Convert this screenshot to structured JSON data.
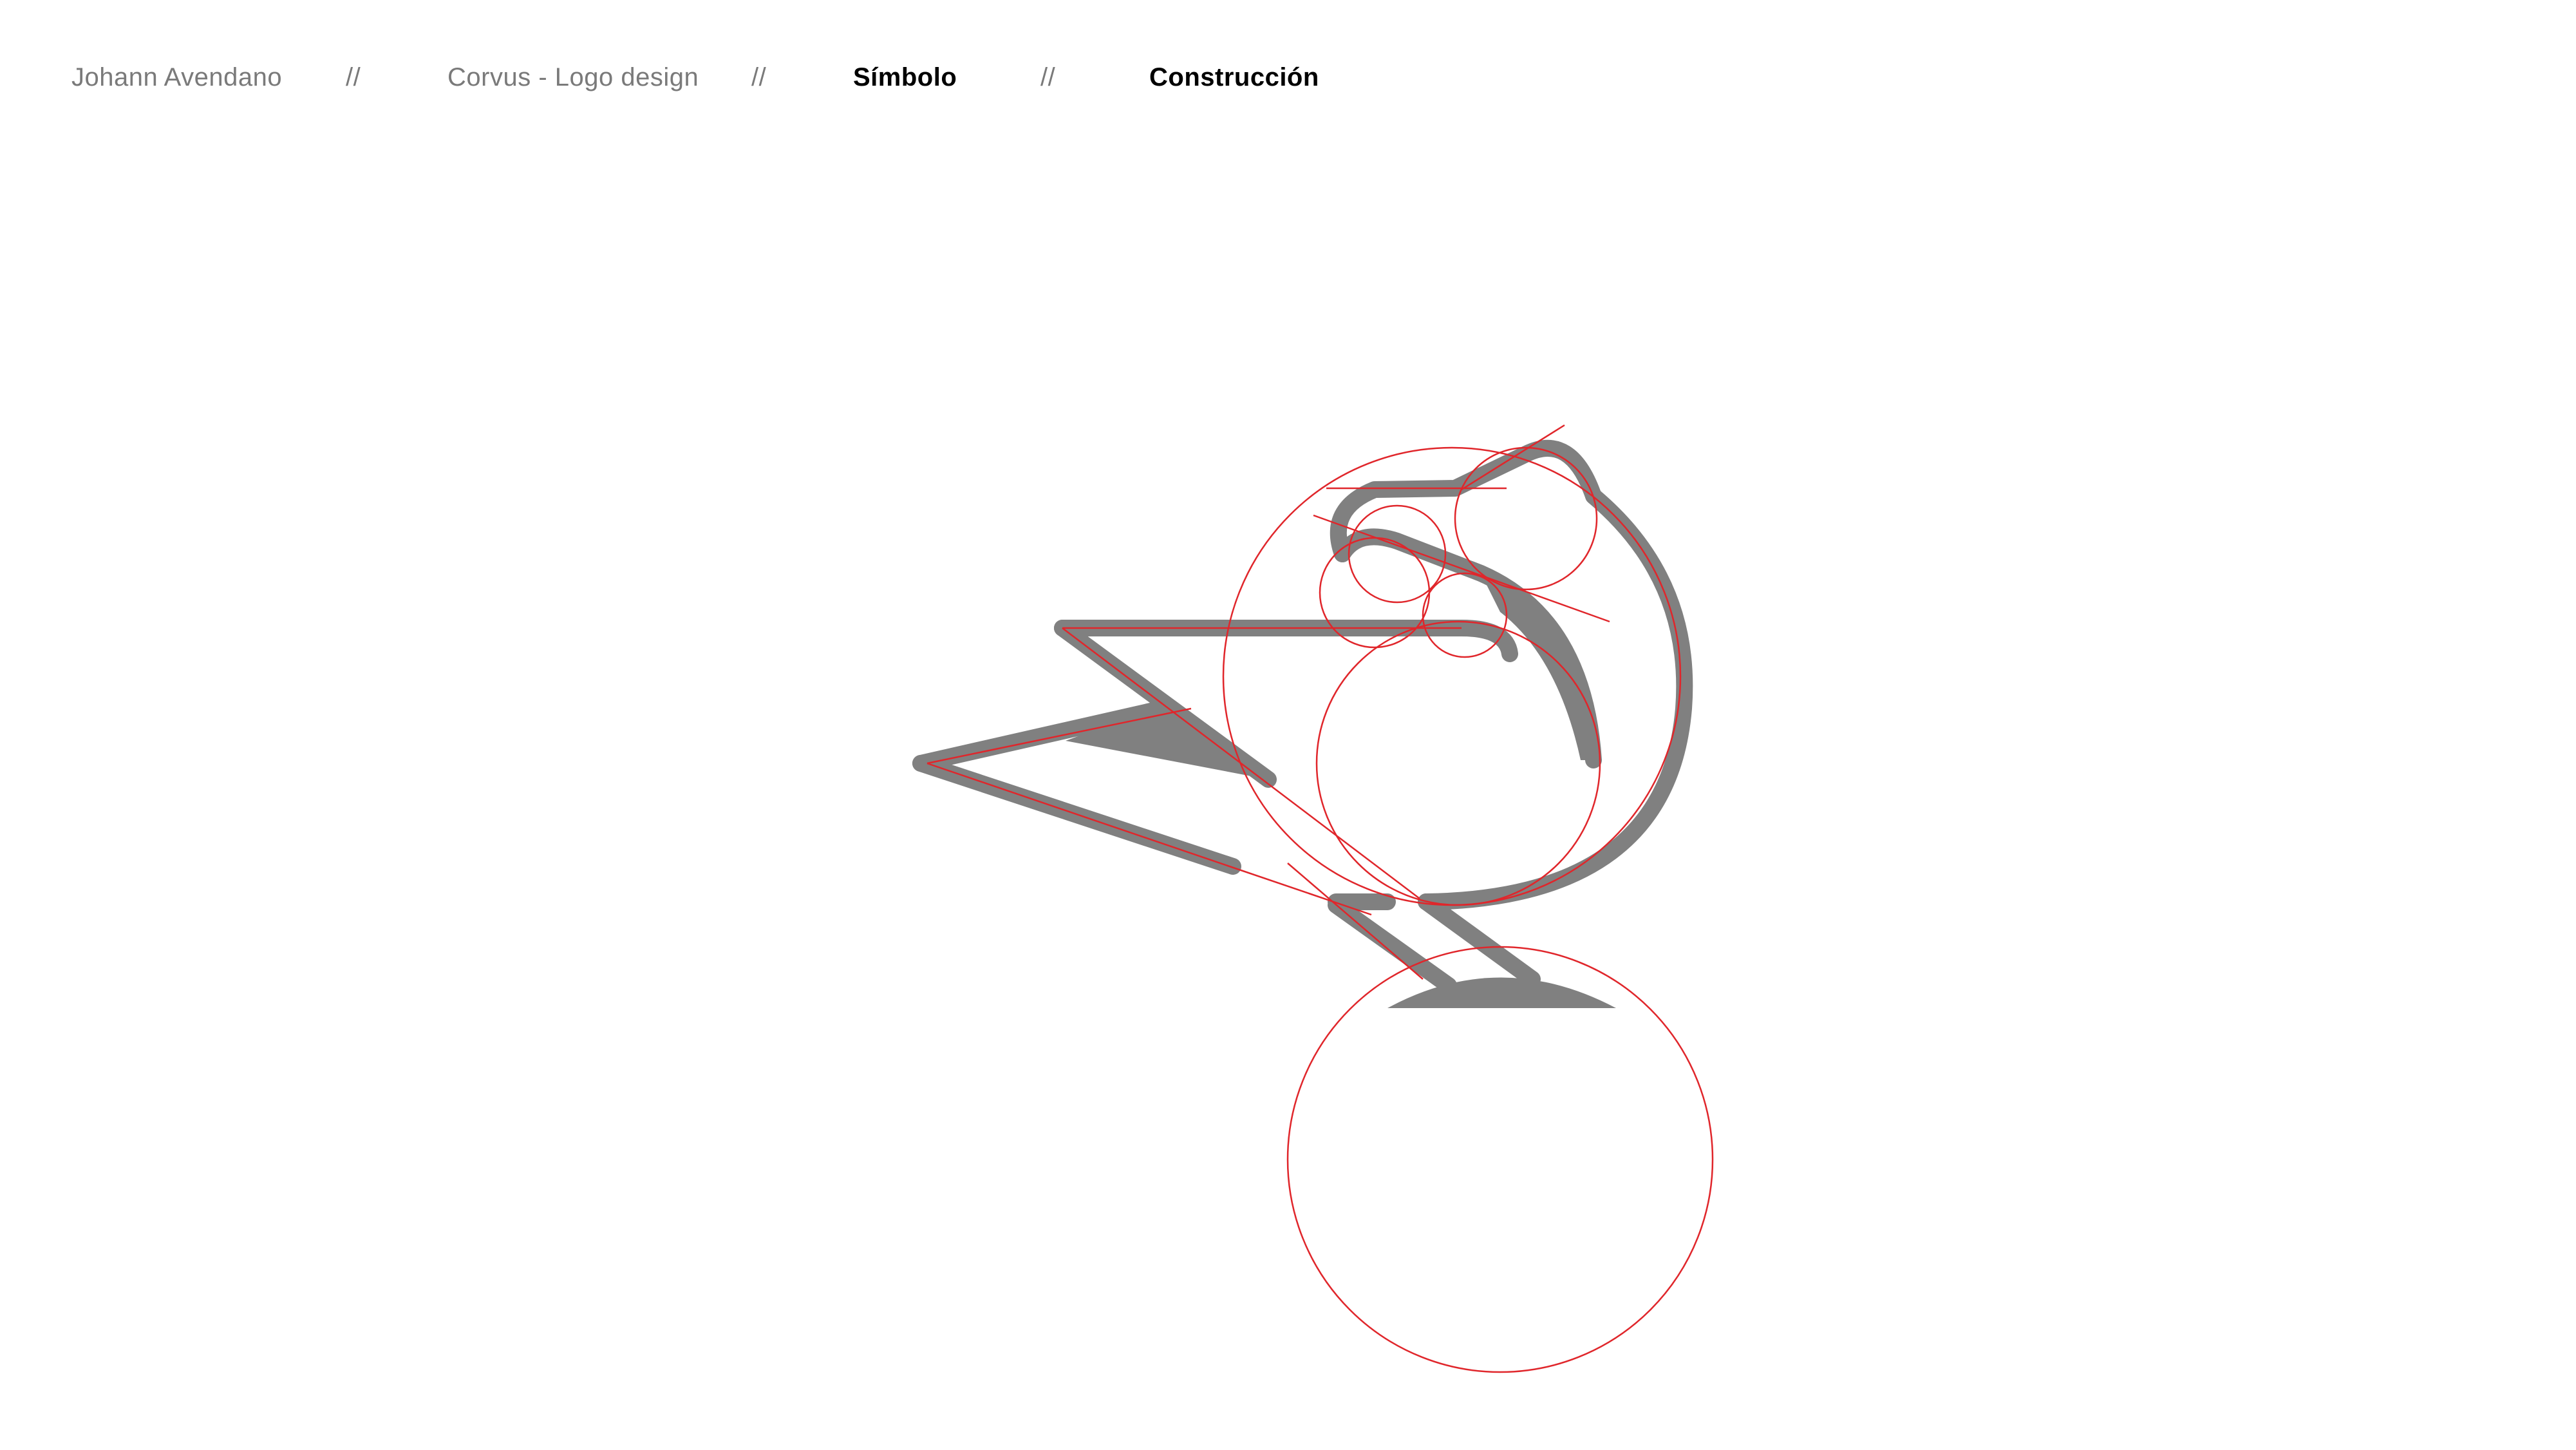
{
  "breadcrumb": {
    "author": "Johann Avendano",
    "separator": "//",
    "project": "Corvus - Logo design",
    "section": "Símbolo",
    "subsection": "Construcción"
  },
  "logo": {
    "description_icon": "corvus-bird-icon",
    "shape_color": "#808080",
    "guide_color": "#e0262b"
  },
  "colors": {
    "text_muted": "#7a7a7a",
    "text_active": "#000000",
    "background": "#ffffff"
  }
}
